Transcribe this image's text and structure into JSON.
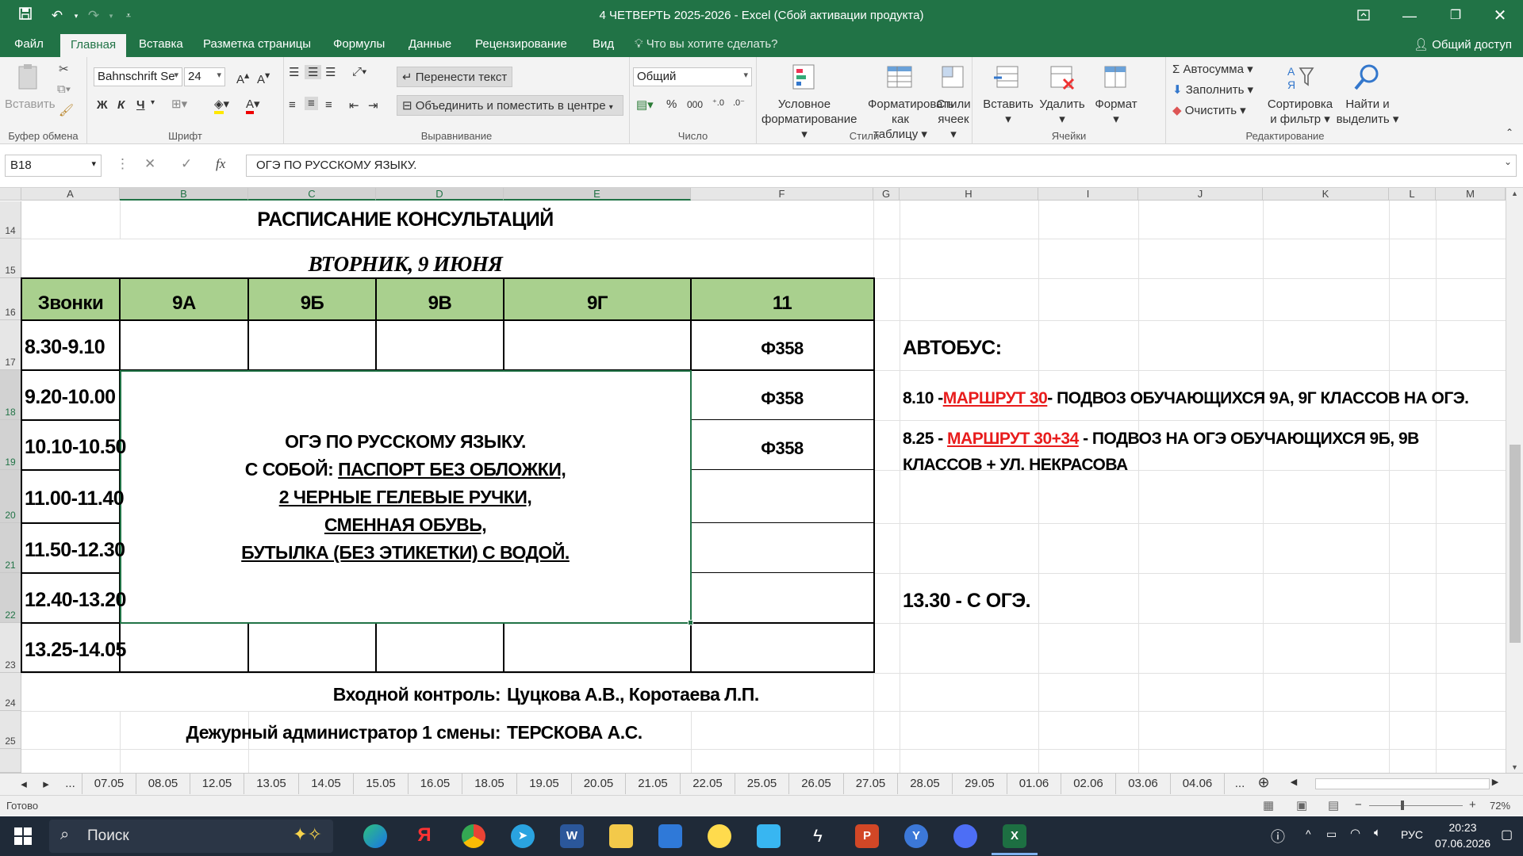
{
  "window": {
    "title": "4 ЧЕТВЕРТЬ 2025-2026 - Excel (Сбой активации продукта)"
  },
  "tabs": {
    "file": "Файл",
    "home": "Главная",
    "insert": "Вставка",
    "layout": "Разметка страницы",
    "formulas": "Формулы",
    "data": "Данные",
    "review": "Рецензирование",
    "view": "Вид",
    "tell": "Что вы хотите сделать?",
    "share": "Общий доступ"
  },
  "ribbon": {
    "clipboard": {
      "paste": "Вставить",
      "label": "Буфер обмена"
    },
    "font": {
      "name": "Bahnschrift Se",
      "size": "24",
      "bold": "Ж",
      "italic": "К",
      "underline": "Ч",
      "label": "Шрифт"
    },
    "align": {
      "wrap": "Перенести текст",
      "merge": "Объединить и поместить в центре",
      "label": "Выравнивание"
    },
    "number": {
      "format": "Общий",
      "label": "Число",
      "percent": "%",
      "thousands": "000"
    },
    "styles": {
      "cond1": "Условное",
      "cond2": "форматирование",
      "table1": "Форматировать",
      "table2": "как таблицу",
      "cell1": "Стили",
      "cell2": "ячеек",
      "label": "Стили"
    },
    "cells": {
      "insert": "Вставить",
      "delete": "Удалить",
      "format": "Формат",
      "label": "Ячейки"
    },
    "edit": {
      "autosum": "Автосумма",
      "fill": "Заполнить",
      "clear": "Очистить",
      "sort1": "Сортировка",
      "sort2": "и фильтр",
      "find1": "Найти и",
      "find2": "выделить",
      "label": "Редактирование"
    }
  },
  "formula_bar": {
    "name_box": "B18",
    "formula": "ОГЭ ПО РУССКОМУ ЯЗЫКУ."
  },
  "columns": [
    "A",
    "B",
    "C",
    "D",
    "E",
    "F",
    "G",
    "H",
    "I",
    "J",
    "K",
    "L",
    "M"
  ],
  "rows": [
    "14",
    "15",
    "16",
    "17",
    "18",
    "19",
    "20",
    "21",
    "22",
    "23",
    "24",
    "25"
  ],
  "sheet": {
    "title": "РАСПИСАНИЕ КОНСУЛЬТАЦИЙ",
    "day": "ВТОРНИК, 9 ИЮНЯ",
    "headers": [
      "Звонки",
      "9А",
      "9Б",
      "9В",
      "9Г",
      "11"
    ],
    "times": [
      "8.30-9.10",
      "9.20-10.00",
      "10.10-10.50",
      "11.00-11.40",
      "11.50-12.30",
      "12.40-13.20",
      "13.25-14.05"
    ],
    "f_col": [
      "Ф358",
      "Ф358",
      "Ф358"
    ],
    "merged": [
      "ОГЭ ПО РУССКОМУ ЯЗЫКУ.",
      "С СОБОЙ: ",
      "ПАСПОРТ БЕЗ ОБЛОЖКИ,",
      "2 ЧЕРНЫЕ ГЕЛЕВЫЕ РУЧКИ,",
      "СМЕННАЯ ОБУВЬ,",
      "БУТЫЛКА (БЕЗ ЭТИКЕТКИ) С ВОДОЙ."
    ],
    "bus_title": "АВТОБУС:",
    "bus1_pre": "8.10 - ",
    "bus1_route": "МАРШРУТ 30",
    "bus1_post": " - ПОДВОЗ ОБУЧАЮЩИХСЯ 9А, 9Г КЛАССОВ НА ОГЭ.",
    "bus2_pre": "8.25 - ",
    "bus2_route": "МАРШРУТ 30+34",
    "bus2_post": " - ПОДВОЗ НА ОГЭ ОБУЧАЮЩИХСЯ 9Б, 9В",
    "bus2_line2": "КЛАССОВ + УЛ. НЕКРАСОВА",
    "bus3": "13.30 - С ОГЭ.",
    "control_label": "Входной контроль:",
    "control_value": "Цуцкова А.В., Коротаева Л.П.",
    "duty_label": "Дежурный администратор 1 смены:",
    "duty_value": "ТЕРСКОВА А.С."
  },
  "sheet_tabs": [
    "...",
    "07.05",
    "08.05",
    "12.05",
    "13.05",
    "14.05",
    "15.05",
    "16.05",
    "18.05",
    "19.05",
    "20.05",
    "21.05",
    "22.05",
    "25.05",
    "26.05",
    "27.05",
    "28.05",
    "29.05",
    "01.06",
    "02.06",
    "03.06",
    "04.06",
    "..."
  ],
  "status": {
    "ready": "Готово",
    "zoom": "72%"
  },
  "taskbar": {
    "search": "Поиск",
    "lang": "РУС",
    "time": "20:23",
    "date": "07.06.2026"
  }
}
